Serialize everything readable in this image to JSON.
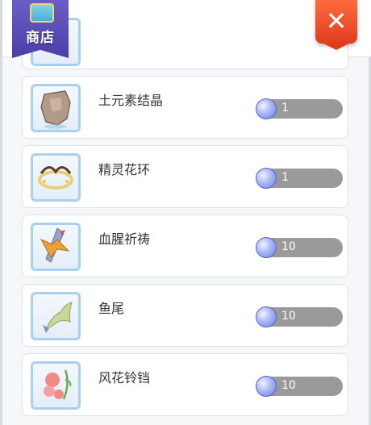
{
  "header": {
    "badge_label": "商店",
    "badge_icon": "shop-chest-icon",
    "close_icon": "close-icon"
  },
  "currency_icon": "gem-icon",
  "items": [
    {
      "name": "土元素结晶",
      "icon": "rock-crystal-icon",
      "price": "1"
    },
    {
      "name": "精灵花环",
      "icon": "flower-wreath-icon",
      "price": "1"
    },
    {
      "name": "血腥祈祷",
      "icon": "crystal-blade-icon",
      "price": "10"
    },
    {
      "name": "鱼尾",
      "icon": "fish-tail-icon",
      "price": "10"
    },
    {
      "name": "风花铃铛",
      "icon": "bell-flower-icon",
      "price": "10"
    }
  ],
  "colors": {
    "badge": "#4a3fa6",
    "close": "#e03d1f",
    "price_pill": "#9a9a9a",
    "thumb_border": "#a9d0ec"
  }
}
